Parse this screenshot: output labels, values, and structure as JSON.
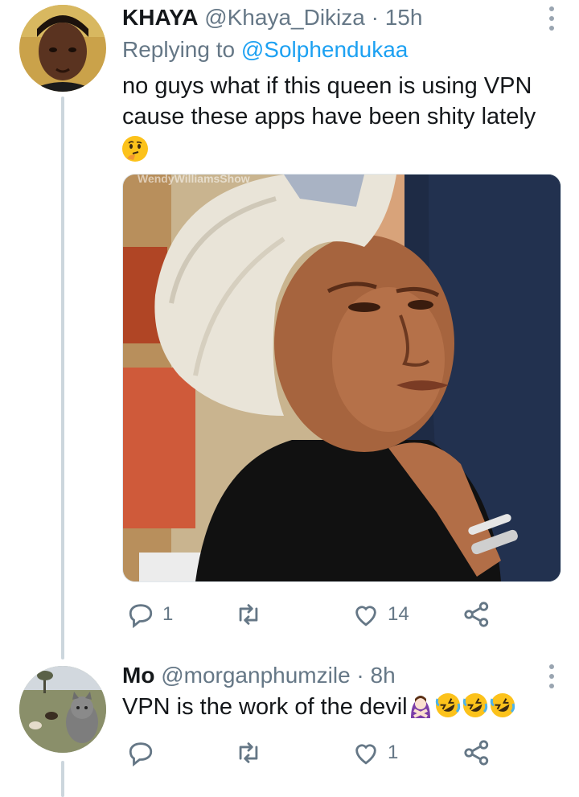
{
  "tweet1": {
    "name": "KHAYA",
    "handle": "@Khaya_Dikiza",
    "separator": "·",
    "time": "15h",
    "replying_prefix": "Replying to",
    "replying_mention": "@Solphendukaa",
    "text_line1": "no guys what if this queen is using VPN",
    "text_line2": "cause these apps have been shity lately",
    "emoji": "thinking-face",
    "media_watermark": "WendyWilliamsShow",
    "reply_count": "1",
    "retweet_count": "",
    "like_count": "14"
  },
  "tweet2": {
    "name": "Mo",
    "handle": "@morganphumzile",
    "separator": "·",
    "time": "8h",
    "text": "VPN is the work of the devil",
    "emojis": [
      "woman-gesturing-no",
      "rolling-on-floor-laughing",
      "rolling-on-floor-laughing",
      "rolling-on-floor-laughing"
    ],
    "reply_count": "",
    "retweet_count": "",
    "like_count": "1"
  },
  "colors": {
    "text": "#14171a",
    "secondary": "#657786",
    "link": "#1da1f2",
    "thread_line": "#ccd6dd"
  }
}
